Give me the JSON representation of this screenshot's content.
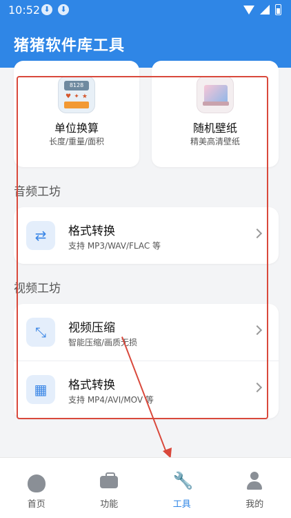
{
  "status_bar": {
    "time": "10:52",
    "download_icons": [
      "download-icon",
      "download-icon"
    ],
    "icons": [
      "wifi-icon",
      "signal-icon",
      "battery-icon"
    ]
  },
  "app_bar": {
    "title": "猪猪软件库工具"
  },
  "top_cards": [
    {
      "title": "单位换算",
      "subtitle": "长度/重量/面积",
      "icon": "calculator-icon"
    },
    {
      "title": "随机壁纸",
      "subtitle": "精美高清壁纸",
      "icon": "wallpaper-icon"
    }
  ],
  "audio_section": {
    "title": "音频工坊",
    "items": [
      {
        "title": "格式转换",
        "subtitle": "支持 MP3/WAV/FLAC 等",
        "icon": "swap-arrows-icon"
      }
    ]
  },
  "video_section": {
    "title": "视频工坊",
    "items": [
      {
        "title": "视频压缩",
        "subtitle": "智能压缩/画质无损",
        "icon": "compress-icon"
      },
      {
        "title": "格式转换",
        "subtitle": "支持 MP4/AVI/MOV 等",
        "icon": "film-icon"
      }
    ]
  },
  "tab_bar": {
    "tabs": [
      {
        "label": "首页",
        "icon": "piggy-bank-icon",
        "active": false
      },
      {
        "label": "功能",
        "icon": "toolbox-icon",
        "active": false
      },
      {
        "label": "工具",
        "icon": "wrench-icon",
        "active": true
      },
      {
        "label": "我的",
        "icon": "person-icon",
        "active": false
      }
    ]
  },
  "colors": {
    "primary": "#2f86e6",
    "annotation": "#d9483b",
    "background": "#f3f4f6"
  }
}
